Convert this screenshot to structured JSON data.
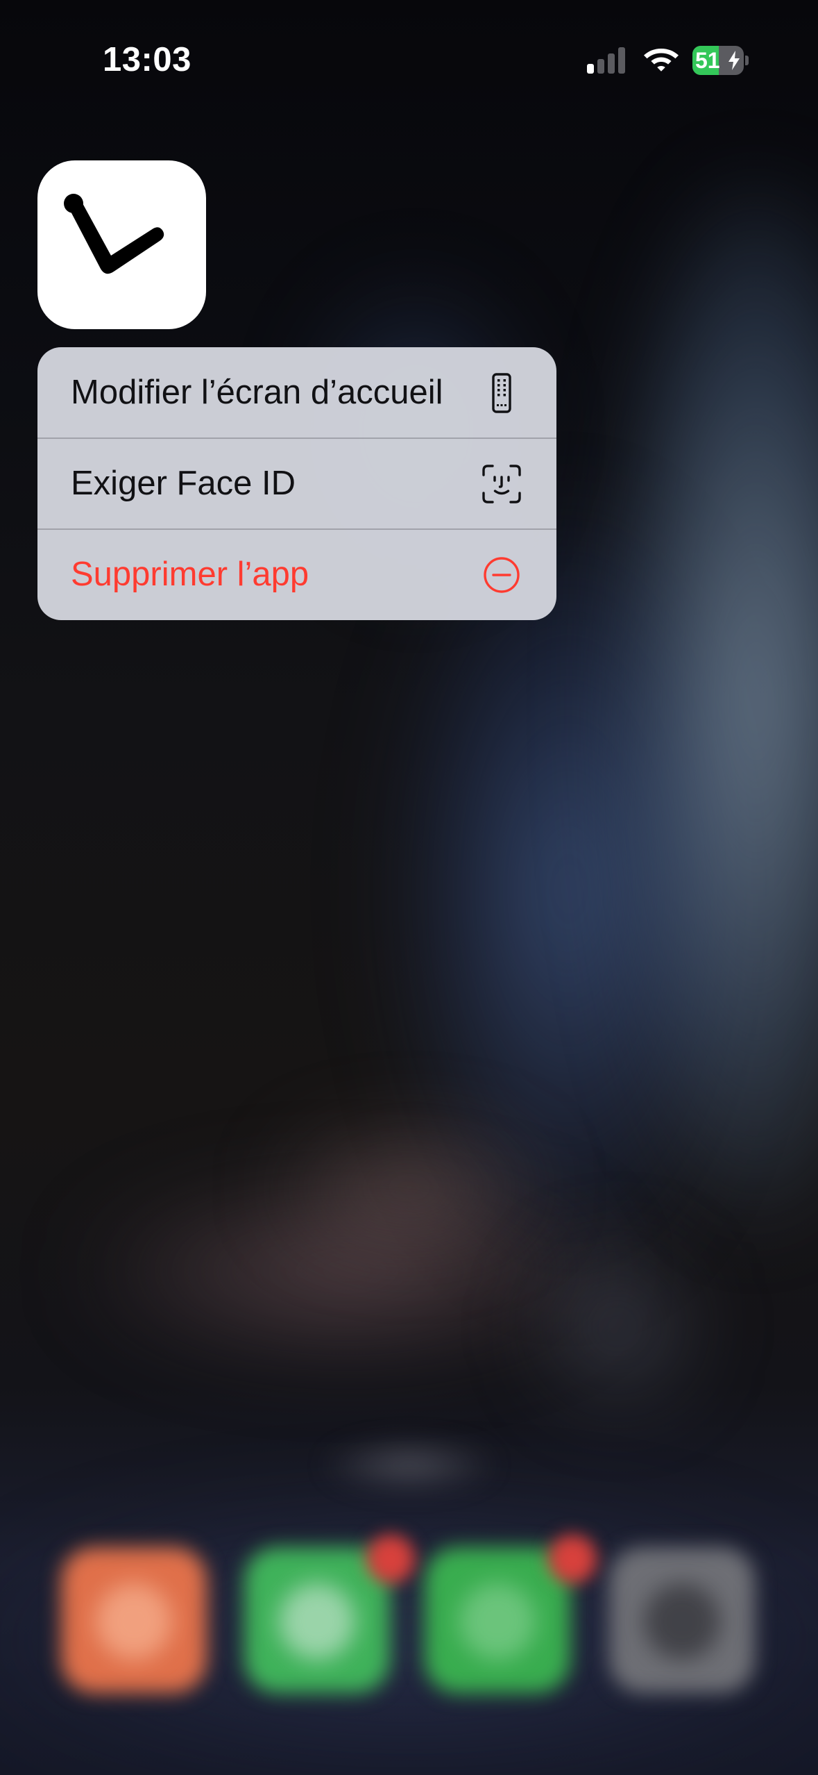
{
  "status_bar": {
    "time": "13:03",
    "battery_level": "51",
    "battery_fraction": 0.51,
    "charging": true,
    "signal_bars_active": 1,
    "signal_bars_total": 4
  },
  "app_icon": {
    "icon": "checkmark-logo-icon",
    "background": "#FFFFFF",
    "glyph_color": "#000000"
  },
  "context_menu": {
    "items": [
      {
        "label": "Modifier l’écran d’accueil",
        "icon": "home-screen-edit-icon",
        "destructive": false
      },
      {
        "label": "Exiger Face ID",
        "icon": "face-id-icon",
        "destructive": false
      },
      {
        "label": "Supprimer l’app",
        "icon": "minus-circle-icon",
        "destructive": true
      }
    ]
  },
  "colors": {
    "destructive": "#FF3B30",
    "battery_green": "#34C759",
    "menu_background": "#D2D4DC"
  }
}
